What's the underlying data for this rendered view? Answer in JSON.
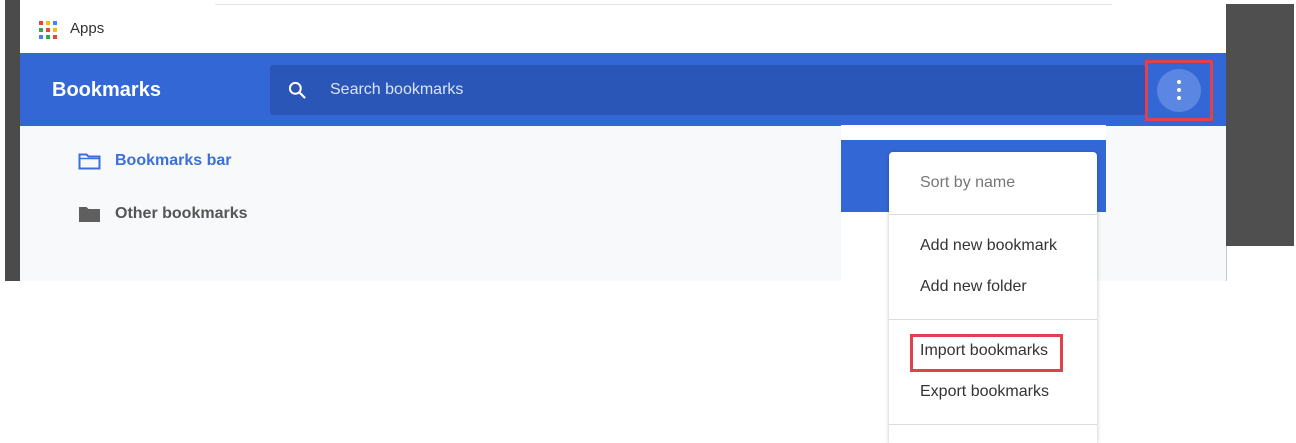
{
  "apps_bar": {
    "label": "Apps",
    "grid_colors": [
      "#ea4335",
      "#fbbc05",
      "#4285f4",
      "#34a853",
      "#ea4335",
      "#fbbc05",
      "#4285f4",
      "#34a853",
      "#ea4335"
    ]
  },
  "header": {
    "title": "Bookmarks",
    "search_placeholder": "Search bookmarks",
    "menu_icon": "more-vert-icon",
    "highlight_color": "#e0414d"
  },
  "tree": {
    "items": [
      {
        "label": "Bookmarks bar",
        "icon": "folder-outline-icon",
        "selected": true
      },
      {
        "label": "Other bookmarks",
        "icon": "folder-filled-icon",
        "selected": false
      }
    ]
  },
  "menu": {
    "items": [
      {
        "label": "Sort by name",
        "disabled": true
      },
      {
        "label": "Add new bookmark",
        "disabled": false
      },
      {
        "label": "Add new folder",
        "disabled": false
      },
      {
        "label": "Import bookmarks",
        "disabled": false,
        "highlighted": true
      },
      {
        "label": "Export bookmarks",
        "disabled": false
      }
    ]
  },
  "colors": {
    "header_blue": "#3367d6",
    "search_blue": "#2a56b8",
    "selected_text": "#3b6fd9"
  }
}
